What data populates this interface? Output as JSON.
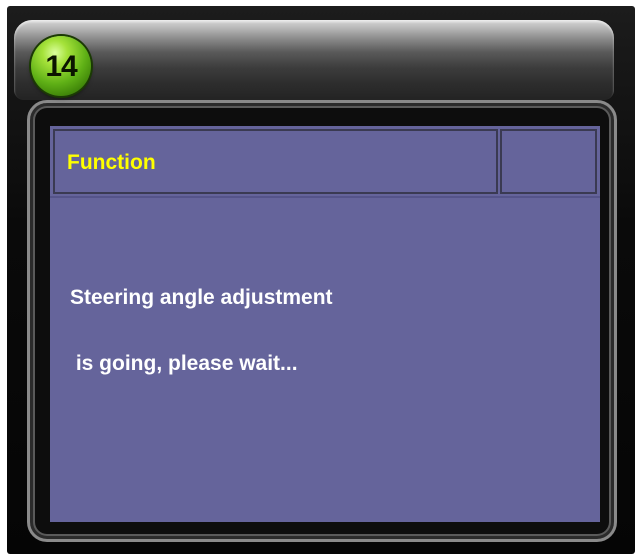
{
  "badge": {
    "number": "14"
  },
  "dialog": {
    "header_title": "Function",
    "header_side": "",
    "message_line1": "Steering angle adjustment",
    "message_line2": " is going, please wait..."
  },
  "colors": {
    "content_bg": "#65649b",
    "title_text": "#ffff00",
    "message_text": "#ffffff",
    "badge_green": "#5fb016"
  }
}
